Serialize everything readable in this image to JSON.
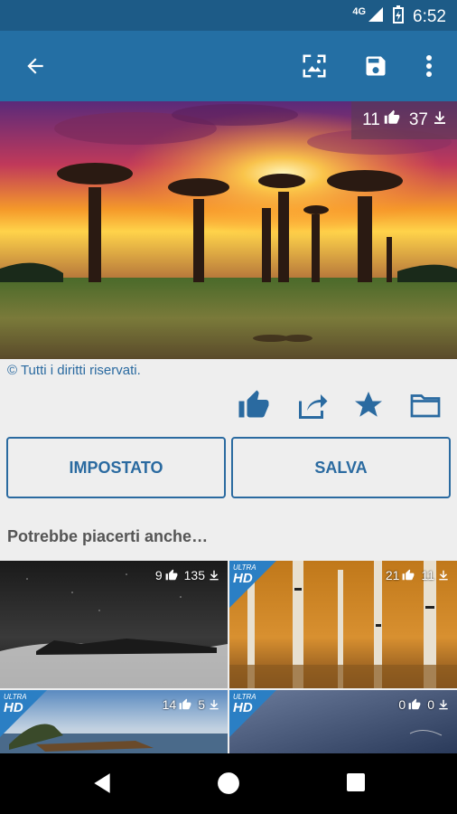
{
  "status_bar": {
    "network": "4G",
    "time": "6:52"
  },
  "app_bar": {
    "icons": [
      "back-arrow-icon",
      "image-icon",
      "save-icon",
      "more-vert-icon"
    ],
    "color": "#246fa4"
  },
  "hero": {
    "likes": "11",
    "downloads": "37"
  },
  "copyright": "© Tutti i diritti riservati.",
  "actions": [
    "like-icon",
    "share-icon",
    "star-icon",
    "folder-icon"
  ],
  "buttons": {
    "set": "IMPOSTATO",
    "save": "SALVA"
  },
  "section_title": "Potrebbe piacerti anche…",
  "uhd_badge": {
    "top": "ULTRA",
    "bottom": "HD"
  },
  "thumbnails": [
    {
      "likes": "9",
      "downloads": "135",
      "ultra_hd": false
    },
    {
      "likes": "21",
      "downloads": "11",
      "ultra_hd": true
    },
    {
      "likes": "14",
      "downloads": "5",
      "ultra_hd": true
    },
    {
      "likes": "0",
      "downloads": "0",
      "ultra_hd": true
    }
  ],
  "accent_color": "#2a6aa0"
}
